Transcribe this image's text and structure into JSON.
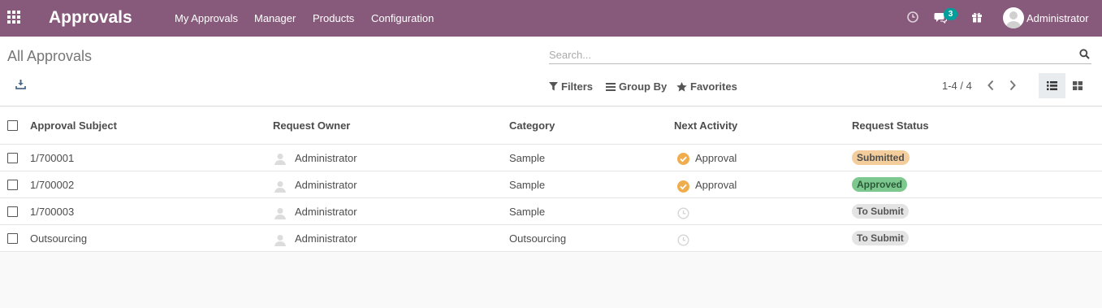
{
  "navbar": {
    "brand": "Approvals",
    "menu": [
      "My Approvals",
      "Manager",
      "Products",
      "Configuration"
    ],
    "messages_badge": "3",
    "user": "Administrator",
    "color": "#875a7b"
  },
  "control_panel": {
    "title": "All Approvals",
    "search_placeholder": "Search...",
    "filters_label": "Filters",
    "group_by_label": "Group By",
    "favorites_label": "Favorites",
    "pager": "1-4 / 4"
  },
  "table": {
    "columns": [
      "Approval Subject",
      "Request Owner",
      "Category",
      "Next Activity",
      "Request Status"
    ],
    "rows": [
      {
        "subject": "1/700001",
        "owner": "Administrator",
        "category": "Sample",
        "activity": "Approval",
        "status": "Submitted",
        "status_kind": "submitted"
      },
      {
        "subject": "1/700002",
        "owner": "Administrator",
        "category": "Sample",
        "activity": "Approval",
        "status": "Approved",
        "status_kind": "approved"
      },
      {
        "subject": "1/700003",
        "owner": "Administrator",
        "category": "Sample",
        "activity": "",
        "status": "To Submit",
        "status_kind": "tosubmit"
      },
      {
        "subject": "Outsourcing",
        "owner": "Administrator",
        "category": "Outsourcing",
        "activity": "",
        "status": "To Submit",
        "status_kind": "tosubmit"
      }
    ]
  },
  "colors": {
    "activity_ok": "#f0ad4e",
    "badge": "#00a09d"
  }
}
